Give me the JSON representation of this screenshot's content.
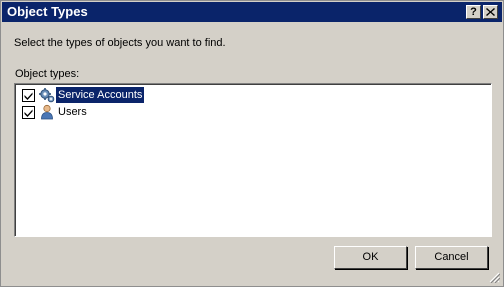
{
  "window": {
    "title": "Object Types",
    "help_glyph": "?",
    "close_glyph": "X"
  },
  "dialog": {
    "instruction": "Select the types of objects you want to find.",
    "list_label": "Object types:",
    "items": [
      {
        "label": "Service Accounts",
        "checked": true,
        "selected": true,
        "icon": "service-accounts-gear-icon"
      },
      {
        "label": "Users",
        "checked": true,
        "selected": false,
        "icon": "user-icon"
      }
    ]
  },
  "buttons": {
    "ok": "OK",
    "cancel": "Cancel"
  },
  "colors": {
    "title_bar": "#0a246a",
    "face": "#d4d0c8",
    "selection": "#0a246a"
  }
}
